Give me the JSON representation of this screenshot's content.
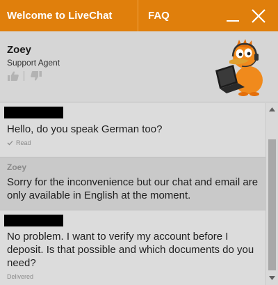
{
  "header": {
    "tab_welcome": "Welcome to LiveChat",
    "tab_faq": "FAQ",
    "minimize_icon": "minimize-icon",
    "close_icon": "close-icon",
    "accent_color": "#e07f0c"
  },
  "agent": {
    "name": "Zoey",
    "role": "Support Agent",
    "rate_good_icon": "thumbs-up-icon",
    "rate_bad_icon": "thumbs-down-icon",
    "avatar_icon": "duck-mascot-with-headset-and-laptop"
  },
  "messages": [
    {
      "sender": "",
      "text": "Hello, do you speak German too?",
      "status": "Read",
      "status_icon": "checkmark-icon"
    },
    {
      "sender": "Zoey",
      "text": "Sorry for the inconvenience but our chat and email are only available in English at the moment.",
      "status": ""
    },
    {
      "sender": "",
      "text": "No problem. I want to verify my account before I deposit. Is that possible and which documents do you need?",
      "status": "Delivered"
    }
  ],
  "scrollbar": {
    "up_icon": "scroll-up-arrow-icon",
    "down_icon": "scroll-down-arrow-icon"
  }
}
